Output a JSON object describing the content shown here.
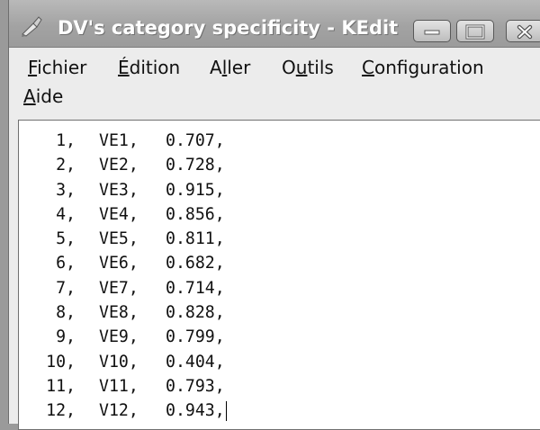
{
  "window": {
    "title": "DV's category specificity - KEdit",
    "icon": "kedit-app-icon",
    "buttons": [
      "minimize-icon",
      "maximize-icon",
      "close-icon"
    ]
  },
  "menu": {
    "items": [
      {
        "label": "Fichier",
        "mnemonic": "F"
      },
      {
        "label": "Édition",
        "mnemonic": "É"
      },
      {
        "label": "Aller",
        "mnemonic": "l"
      },
      {
        "label": "Outils",
        "mnemonic": "u"
      },
      {
        "label": "Configuration",
        "mnemonic": "C"
      },
      {
        "label": "Aide",
        "mnemonic": "A"
      }
    ]
  },
  "document": {
    "lines": [
      {
        "n": "1,",
        "id": "VE1,",
        "v": "0.707,"
      },
      {
        "n": "2,",
        "id": "VE2,",
        "v": "0.728,"
      },
      {
        "n": "3,",
        "id": "VE3,",
        "v": "0.915,"
      },
      {
        "n": "4,",
        "id": "VE4,",
        "v": "0.856,"
      },
      {
        "n": "5,",
        "id": "VE5,",
        "v": "0.811,"
      },
      {
        "n": "6,",
        "id": "VE6,",
        "v": "0.682,"
      },
      {
        "n": "7,",
        "id": "VE7,",
        "v": "0.714,"
      },
      {
        "n": "8,",
        "id": "VE8,",
        "v": "0.828,"
      },
      {
        "n": "9,",
        "id": "VE9,",
        "v": "0.799,"
      },
      {
        "n": "10,",
        "id": "V10,",
        "v": "0.404,"
      },
      {
        "n": "11,",
        "id": "V11,",
        "v": "0.793,"
      },
      {
        "n": "12,",
        "id": "V12,",
        "v": "0.943,"
      }
    ]
  }
}
